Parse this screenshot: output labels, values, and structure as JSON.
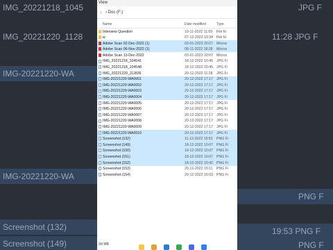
{
  "window": {
    "title_fragment": "View"
  },
  "address": {
    "back_icon": "back-arrow-icon",
    "forward_icon": "forward-arrow-icon",
    "up_icon": "up-arrow-icon",
    "path": "›  Doc (F:)"
  },
  "columns": {
    "name": "Name",
    "date": "Date modified",
    "type": "Type"
  },
  "files": [
    {
      "name": "Interview Question",
      "date": "10-11-2022 11:09",
      "type": "File fo",
      "icon": "folder",
      "selected": false
    },
    {
      "name": "w",
      "date": "07-12-2022 19:34",
      "type": "File fo",
      "icon": "folder",
      "selected": false
    },
    {
      "name": "Adobe Scan 02-Dec-2022 (1)",
      "date": "03-01-2023 20:07",
      "type": "Micros",
      "icon": "pdf",
      "selected": true
    },
    {
      "name": "Adobe Scan 06-Nov-2022 (1)",
      "date": "08-11-2022 18:28",
      "type": "Micros",
      "icon": "pdf",
      "selected": true
    },
    {
      "name": "Adobe Scan 13-Dec-2022",
      "date": "03-01-2023 20:07",
      "type": "Micros",
      "icon": "pdf",
      "selected": false
    },
    {
      "name": "IMG_20221218_104541",
      "date": "18-12-2022 10:45",
      "type": "JPG Fi",
      "icon": "img",
      "selected": false
    },
    {
      "name": "IMG_20221218_104548",
      "date": "18-12-2022 10:45",
      "type": "JPG Fi",
      "icon": "img",
      "selected": false
    },
    {
      "name": "IMG_20221220_112835",
      "date": "20-12-2022 11:28",
      "type": "JPG Fi",
      "icon": "img",
      "selected": false
    },
    {
      "name": "IMG-20221220-WA0001",
      "date": "20-12-2022 17:17",
      "type": "JPG Fi",
      "icon": "img",
      "selected": true
    },
    {
      "name": "IMG-20221220-WA0002",
      "date": "20-12-2022 17:17",
      "type": "JPG Fi",
      "icon": "img",
      "selected": true
    },
    {
      "name": "IMG-20221220-WA0003",
      "date": "20-12-2022 17:17",
      "type": "JPG Fi",
      "icon": "img",
      "selected": true
    },
    {
      "name": "IMG-20221220-WA0004",
      "date": "20-12-2022 17:17",
      "type": "JPG Fi",
      "icon": "img",
      "selected": true
    },
    {
      "name": "IMG-20221220-WA0005",
      "date": "20-12-2022 17:17",
      "type": "JPG Fi",
      "icon": "img",
      "selected": false
    },
    {
      "name": "IMG-20221220-WA0006",
      "date": "20-12-2022 17:17",
      "type": "JPG Fi",
      "icon": "img",
      "selected": false
    },
    {
      "name": "IMG-20221220-WA0007",
      "date": "20-12-2022 17:17",
      "type": "JPG Fi",
      "icon": "img",
      "selected": false
    },
    {
      "name": "IMG-20221220-WA0008",
      "date": "20-12-2022 17:17",
      "type": "JPG Fi",
      "icon": "img",
      "selected": false
    },
    {
      "name": "IMG-20221220-WA0009",
      "date": "20-12-2022 17:17",
      "type": "JPG Fi",
      "icon": "img",
      "selected": false
    },
    {
      "name": "IMG-20221220-WA0010",
      "date": "20-12-2022 17:17",
      "type": "JPG Fi",
      "icon": "img",
      "selected": true
    },
    {
      "name": "Screenshot (132)",
      "date": "11-12-2022 19:53",
      "type": "PNG Fi",
      "icon": "img",
      "selected": true
    },
    {
      "name": "Screenshot (149)",
      "date": "18-12-2022 10:07",
      "type": "PNG Fi",
      "icon": "img",
      "selected": true
    },
    {
      "name": "Screenshot (150)",
      "date": "18-12-2022 10:07",
      "type": "PNG Fi",
      "icon": "img",
      "selected": true
    },
    {
      "name": "Screenshot (151)",
      "date": "18-12-2022 10:07",
      "type": "PNG Fi",
      "icon": "img",
      "selected": true
    },
    {
      "name": "Screenshot (152)",
      "date": "18-12-2022 10:42",
      "type": "PNG Fi",
      "icon": "img",
      "selected": true
    },
    {
      "name": "Screenshot (153)",
      "date": "20-12-2022 15:11",
      "type": "PNG Fi",
      "icon": "img",
      "selected": false
    },
    {
      "name": "Screenshot (154)",
      "date": "20-12-2022 16:03",
      "type": "PNG Fi",
      "icon": "img",
      "selected": false
    }
  ],
  "status": {
    "size": ".59 MB"
  },
  "background_left": [
    {
      "text": "IMG_20221218_1045",
      "selected": false
    },
    {
      "text": "IMG_20221220_1128",
      "selected": false
    },
    {
      "text": "IMG-20221220-WA",
      "selected": true
    },
    {
      "text": "IMG-20221220-WA",
      "selected": true
    },
    {
      "text": "Screenshot (132)",
      "selected": true
    },
    {
      "text": "Screenshot (149)",
      "selected": true
    }
  ],
  "background_right": [
    {
      "text": "JPG F",
      "selected": false
    },
    {
      "text": "11:28  JPG F",
      "selected": false
    },
    {
      "text": "PNG F",
      "selected": true
    },
    {
      "text": "19:53  PNG F",
      "selected": true
    },
    {
      "text": "PNG F",
      "selected": true
    }
  ],
  "colors": {
    "selection": "#cce8ff",
    "folder": "#f7c948",
    "pdf": "#d93838",
    "bg_dark": "#2a2f38"
  },
  "taskbar_icons": [
    "file-explorer-icon",
    "paint-icon",
    "edge-icon",
    "chrome-icon",
    "store-icon",
    "mail-icon"
  ]
}
